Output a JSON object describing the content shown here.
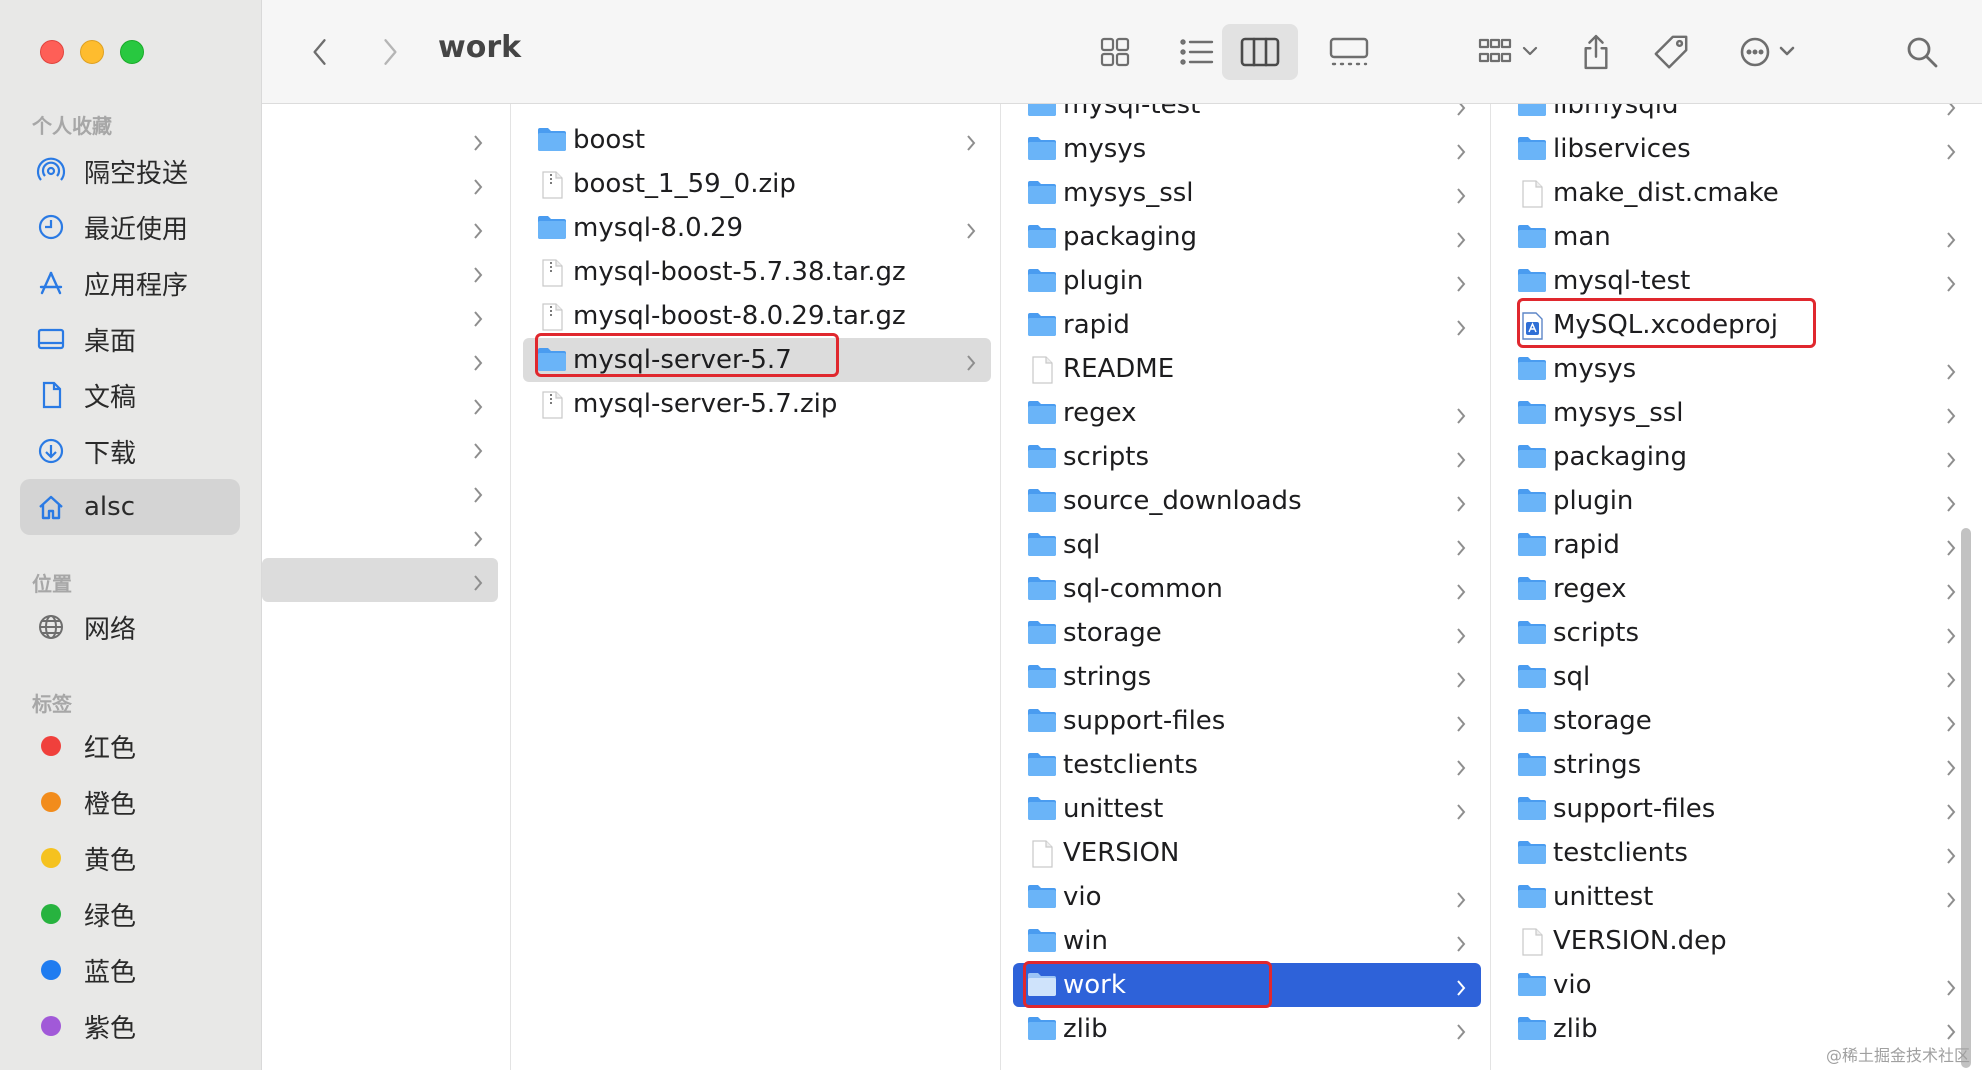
{
  "window": {
    "title": "work"
  },
  "sidebar": {
    "sections": [
      {
        "title": "个人收藏",
        "items": [
          {
            "label": "隔空投送",
            "icon": "airdrop-icon"
          },
          {
            "label": "最近使用",
            "icon": "clock-icon"
          },
          {
            "label": "应用程序",
            "icon": "applications-icon"
          },
          {
            "label": "桌面",
            "icon": "desktop-icon"
          },
          {
            "label": "文稿",
            "icon": "document-icon"
          },
          {
            "label": "下载",
            "icon": "download-icon"
          },
          {
            "label": "alsc",
            "icon": "home-icon",
            "selected": true
          }
        ]
      },
      {
        "title": "位置",
        "items": [
          {
            "label": "网络",
            "icon": "globe-icon"
          }
        ]
      },
      {
        "title": "标签",
        "items": [
          {
            "label": "红色",
            "color": "#f0403c"
          },
          {
            "label": "橙色",
            "color": "#f28c1c"
          },
          {
            "label": "黄色",
            "color": "#f5c21f"
          },
          {
            "label": "绿色",
            "color": "#27b33f"
          },
          {
            "label": "蓝色",
            "color": "#1f7cf0"
          },
          {
            "label": "紫色",
            "color": "#a159d8"
          }
        ]
      }
    ]
  },
  "toolbar": {
    "back_icon": "chevron-left-icon",
    "forward_icon": "chevron-right-icon",
    "view_modes": [
      "icon-view-icon",
      "list-view-icon",
      "column-view-icon",
      "gallery-view-icon"
    ],
    "selected_view": "column-view-icon",
    "group_icon": "group-icon",
    "share_icon": "share-icon",
    "tag_icon": "tag-icon",
    "more_icon": "more-icon",
    "search_icon": "search-icon"
  },
  "columns": [
    {
      "entries": [
        {
          "name": "",
          "folder": true
        },
        {
          "name": "",
          "folder": true
        },
        {
          "name": "",
          "folder": true
        },
        {
          "name": "",
          "folder": true
        },
        {
          "name": "",
          "folder": true
        },
        {
          "name": "",
          "folder": true
        },
        {
          "name": "",
          "folder": true
        },
        {
          "name": "",
          "folder": true
        },
        {
          "name": "",
          "folder": true
        },
        {
          "name": "",
          "folder": true
        },
        {
          "name": "",
          "folder": true,
          "selected": "grey"
        }
      ]
    },
    {
      "entries": [
        {
          "name": "boost",
          "folder": true
        },
        {
          "name": "boost_1_59_0.zip",
          "folder": false,
          "kind": "zip"
        },
        {
          "name": "mysql-8.0.29",
          "folder": true
        },
        {
          "name": "mysql-boost-5.7.38.tar.gz",
          "folder": false,
          "kind": "zip"
        },
        {
          "name": "mysql-boost-8.0.29.tar.gz",
          "folder": false,
          "kind": "zip"
        },
        {
          "name": "mysql-server-5.7",
          "folder": true,
          "selected": "grey",
          "highlighted": true
        },
        {
          "name": "mysql-server-5.7.zip",
          "folder": false,
          "kind": "zip"
        }
      ]
    },
    {
      "entries": [
        {
          "name": "mysql-test",
          "folder": true
        },
        {
          "name": "mysys",
          "folder": true
        },
        {
          "name": "mysys_ssl",
          "folder": true
        },
        {
          "name": "packaging",
          "folder": true
        },
        {
          "name": "plugin",
          "folder": true
        },
        {
          "name": "rapid",
          "folder": true
        },
        {
          "name": "README",
          "folder": false,
          "kind": "doc"
        },
        {
          "name": "regex",
          "folder": true
        },
        {
          "name": "scripts",
          "folder": true
        },
        {
          "name": "source_downloads",
          "folder": true
        },
        {
          "name": "sql",
          "folder": true
        },
        {
          "name": "sql-common",
          "folder": true
        },
        {
          "name": "storage",
          "folder": true
        },
        {
          "name": "strings",
          "folder": true
        },
        {
          "name": "support-files",
          "folder": true
        },
        {
          "name": "testclients",
          "folder": true
        },
        {
          "name": "unittest",
          "folder": true
        },
        {
          "name": "VERSION",
          "folder": false,
          "kind": "doc"
        },
        {
          "name": "vio",
          "folder": true
        },
        {
          "name": "win",
          "folder": true
        },
        {
          "name": "work",
          "folder": true,
          "selected": "blue",
          "highlighted": true
        },
        {
          "name": "zlib",
          "folder": true
        }
      ]
    },
    {
      "entries": [
        {
          "name": "libmysqld",
          "folder": true
        },
        {
          "name": "libservices",
          "folder": true
        },
        {
          "name": "make_dist.cmake",
          "folder": false,
          "kind": "doc"
        },
        {
          "name": "man",
          "folder": true
        },
        {
          "name": "mysql-test",
          "folder": true
        },
        {
          "name": "MySQL.xcodeproj",
          "folder": false,
          "kind": "xcode",
          "highlighted": true
        },
        {
          "name": "mysys",
          "folder": true
        },
        {
          "name": "mysys_ssl",
          "folder": true
        },
        {
          "name": "packaging",
          "folder": true
        },
        {
          "name": "plugin",
          "folder": true
        },
        {
          "name": "rapid",
          "folder": true
        },
        {
          "name": "regex",
          "folder": true
        },
        {
          "name": "scripts",
          "folder": true
        },
        {
          "name": "sql",
          "folder": true
        },
        {
          "name": "storage",
          "folder": true
        },
        {
          "name": "strings",
          "folder": true
        },
        {
          "name": "support-files",
          "folder": true
        },
        {
          "name": "testclients",
          "folder": true
        },
        {
          "name": "unittest",
          "folder": true
        },
        {
          "name": "VERSION.dep",
          "folder": false,
          "kind": "doc"
        },
        {
          "name": "vio",
          "folder": true
        },
        {
          "name": "zlib",
          "folder": true
        }
      ]
    }
  ],
  "watermark": "@稀土掘金技术社区"
}
